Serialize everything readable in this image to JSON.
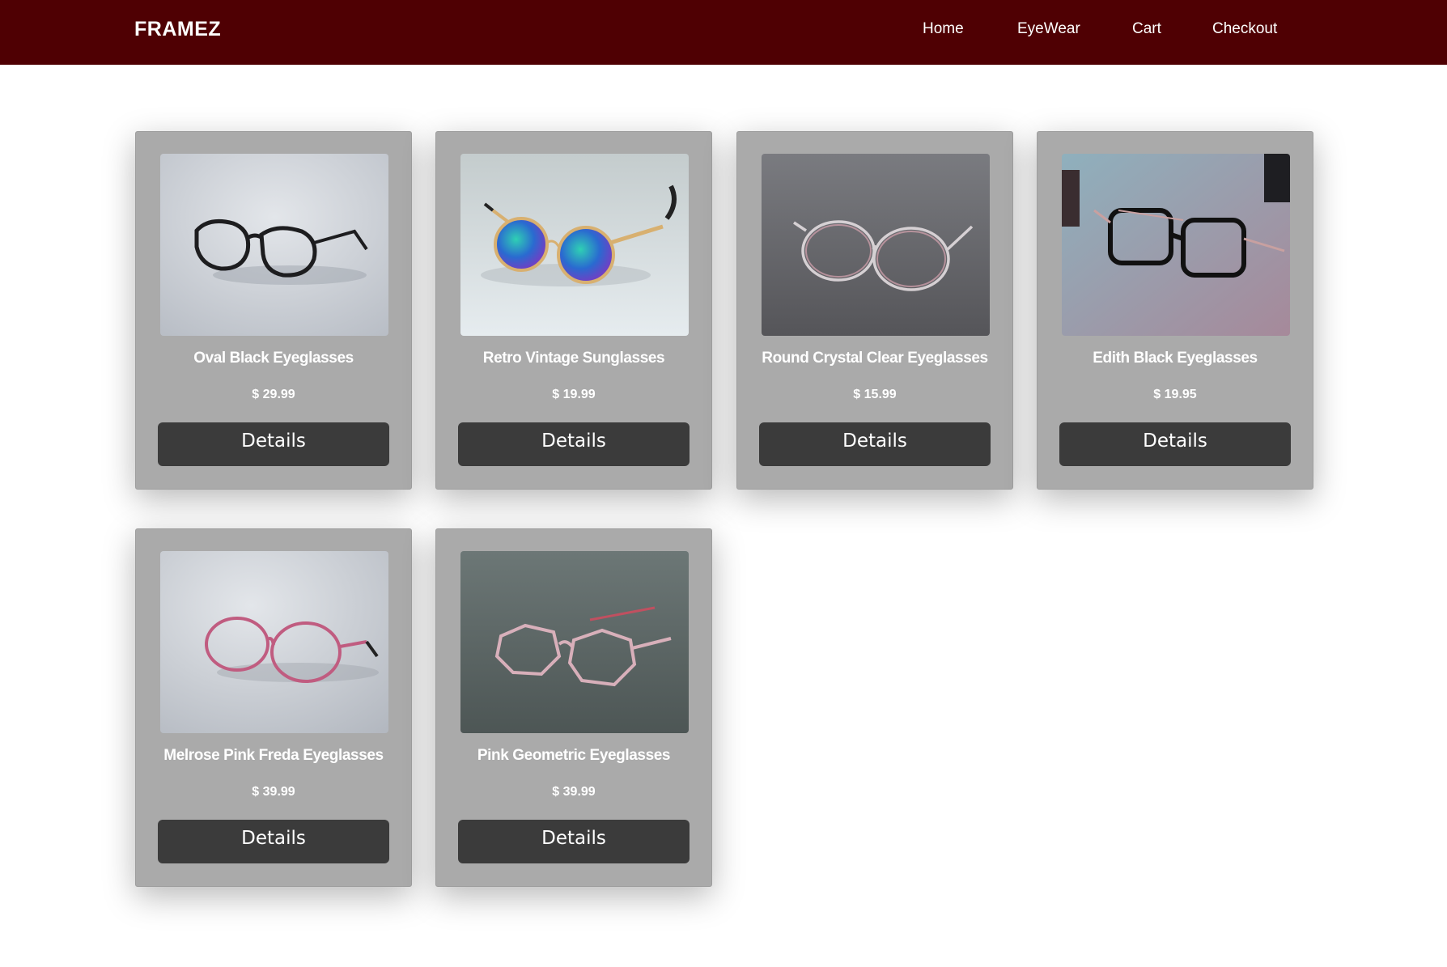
{
  "header": {
    "brand": "FRAMEZ",
    "nav": [
      {
        "label": "Home"
      },
      {
        "label": "EyeWear"
      },
      {
        "label": "Cart"
      },
      {
        "label": "Checkout"
      }
    ]
  },
  "products": [
    {
      "name": "Oval Black Eyeglasses",
      "price": "$ 29.99",
      "button": "Details",
      "image": "black-oval-glasses-photo"
    },
    {
      "name": "Retro Vintage Sunglasses",
      "price": "$ 19.99",
      "button": "Details",
      "image": "round-mirrored-sunglasses-photo"
    },
    {
      "name": "Round Crystal Clear Eyeglasses",
      "price": "$ 15.99",
      "button": "Details",
      "image": "clear-round-glasses-photo"
    },
    {
      "name": "Edith Black Eyeglasses",
      "price": "$ 19.95",
      "button": "Details",
      "image": "black-aviator-glasses-photo"
    },
    {
      "name": "Melrose Pink Freda Eyeglasses",
      "price": "$ 39.99",
      "button": "Details",
      "image": "pink-round-glasses-photo"
    },
    {
      "name": "Pink Geometric Eyeglasses",
      "price": "$ 39.99",
      "button": "Details",
      "image": "pink-geometric-glasses-photo"
    }
  ],
  "colors": {
    "navbar": "#4f0003",
    "card": "#aaaaaa",
    "button": "#3b3b3b",
    "text": "#ffffff"
  }
}
